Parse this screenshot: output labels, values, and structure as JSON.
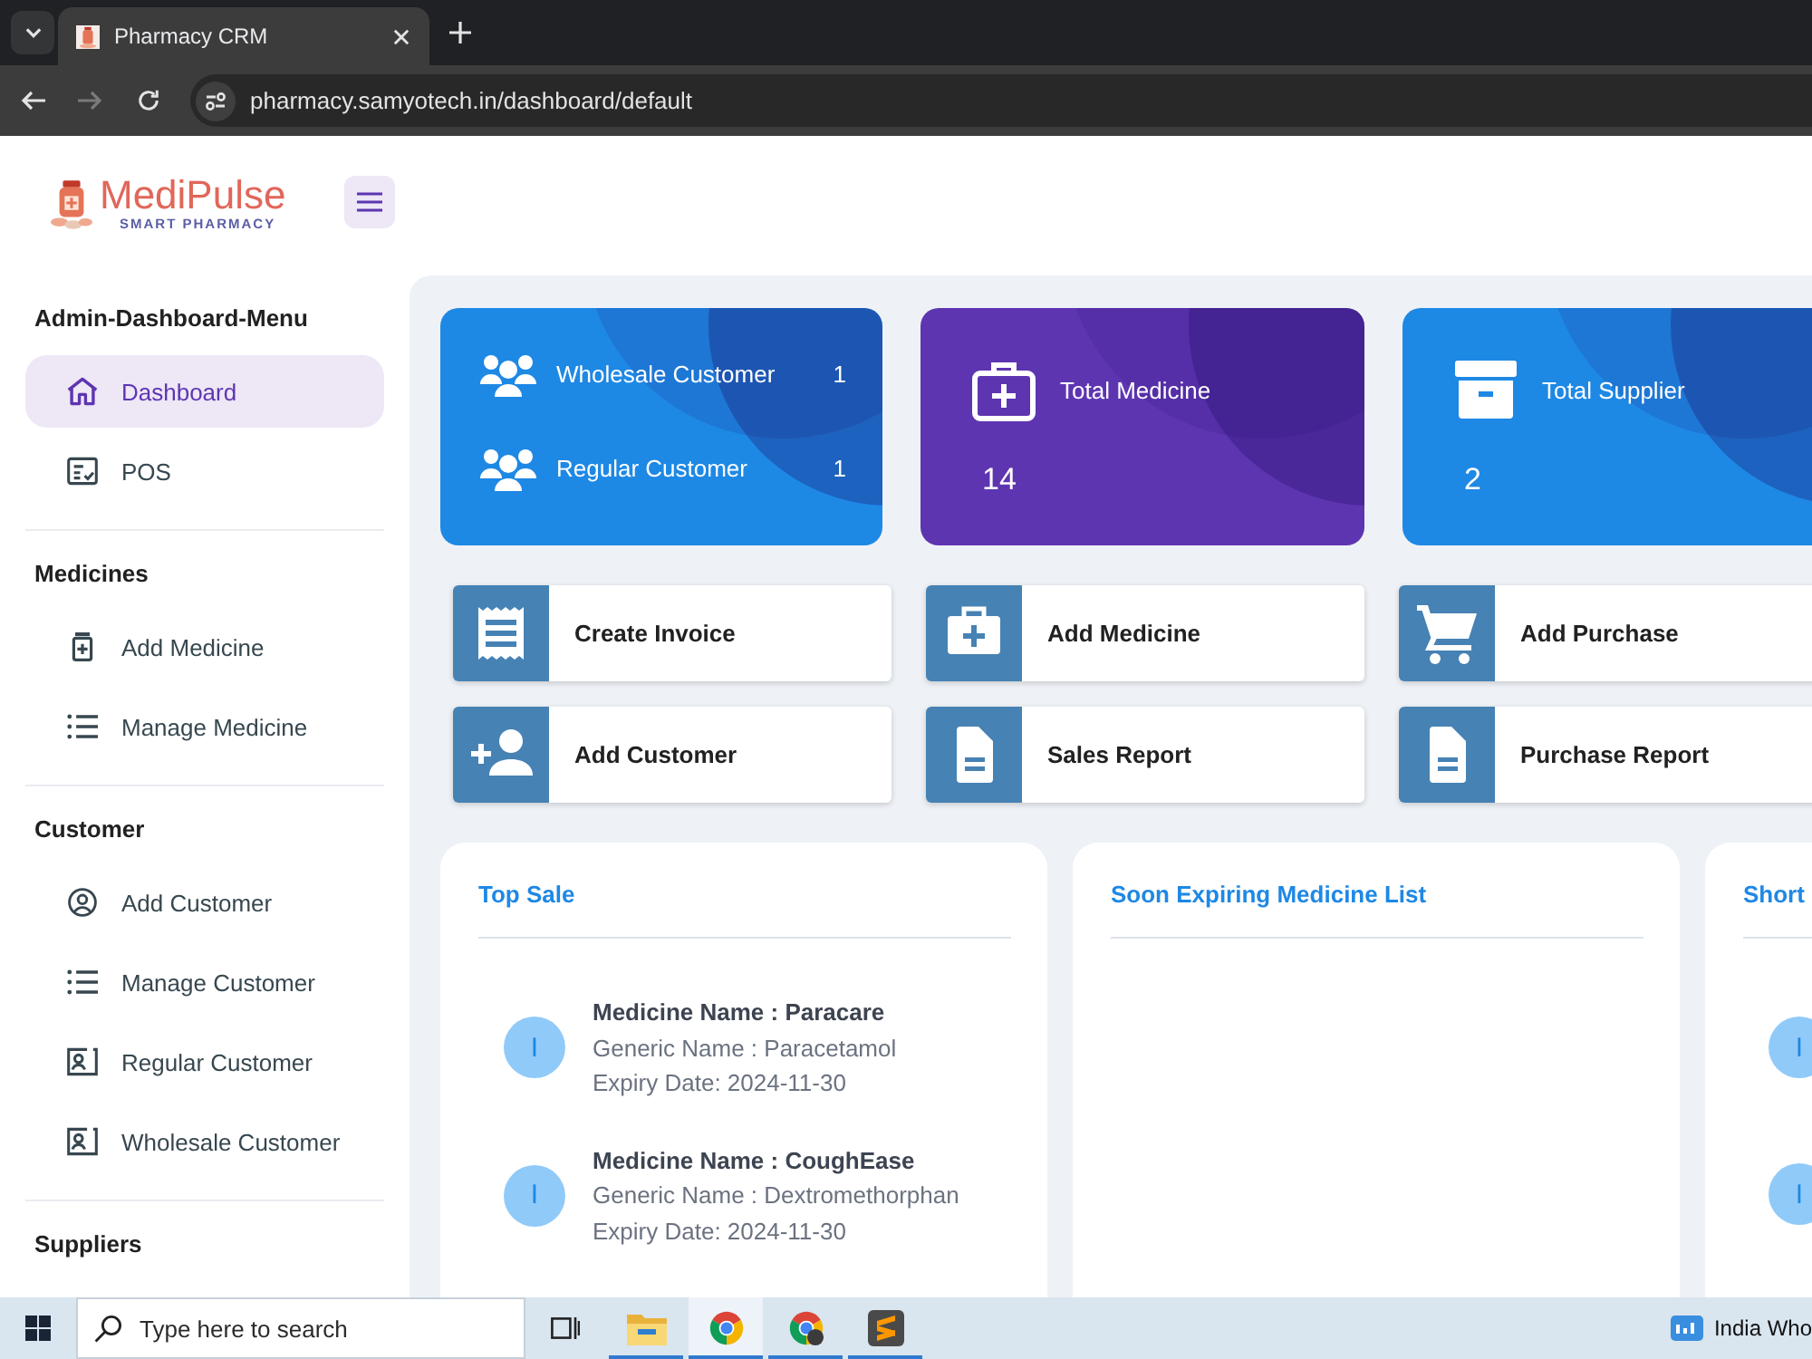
{
  "browser": {
    "tab": {
      "title": "Pharmacy CRM"
    },
    "nav": [
      {
        "kind": "back",
        "disabled": false
      },
      {
        "kind": "forward",
        "disabled": true
      },
      {
        "kind": "reload",
        "disabled": false
      }
    ],
    "url": "pharmacy.samyotech.in/dashboard/default"
  },
  "header": {
    "brand": "MediPulse",
    "tagline": "SMART PHARMACY"
  },
  "sidebar": {
    "sections": [
      {
        "title": "Admin-Dashboard-Menu",
        "items": [
          {
            "label": "Dashboard",
            "kind": "home",
            "selected": true
          },
          {
            "label": "POS",
            "kind": "checklist",
            "selected": false
          }
        ]
      },
      {
        "title": "Medicines",
        "items": [
          {
            "label": "Add Medicine",
            "kind": "medicine-box",
            "selected": false
          },
          {
            "label": "Manage Medicine",
            "kind": "list",
            "selected": false
          }
        ]
      },
      {
        "title": "Customer",
        "items": [
          {
            "label": "Add Customer",
            "kind": "user",
            "selected": false
          },
          {
            "label": "Manage Customer",
            "kind": "list",
            "selected": false
          },
          {
            "label": "Regular Customer",
            "kind": "contact",
            "selected": false
          },
          {
            "label": "Wholesale Customer",
            "kind": "contact",
            "selected": false
          }
        ]
      },
      {
        "title": "Suppliers"
      }
    ]
  },
  "stat_cards": [
    {
      "kind": "customers",
      "color": "#1e88e5",
      "rows": [
        {
          "label": "Wholesale Customer",
          "value": "1"
        },
        {
          "label": "Regular Customer",
          "value": "1"
        }
      ]
    },
    {
      "kind": "medicine",
      "color": "#5e35b1",
      "label": "Total Medicine",
      "value": "14"
    },
    {
      "kind": "supplier",
      "color": "#1e88e5",
      "label": "Total Supplier",
      "value": "2"
    }
  ],
  "quick_actions": [
    {
      "kind": "invoice",
      "label": "Create Invoice"
    },
    {
      "kind": "medicine",
      "label": "Add Medicine"
    },
    {
      "kind": "cart",
      "label": "Add Purchase"
    },
    {
      "kind": "add-user",
      "label": "Add Customer"
    },
    {
      "kind": "report",
      "label": "Sales Report"
    },
    {
      "kind": "report",
      "label": "Purchase Report"
    }
  ],
  "panels": [
    {
      "title": "Top Sale",
      "items": [
        {
          "avatar": "I",
          "name": "Medicine Name : Paracare",
          "generic": "Generic Name : Paracetamol",
          "expiry": "Expiry Date: 2024-11-30"
        },
        {
          "avatar": "I",
          "name": "Medicine Name : CoughEase",
          "generic": "Generic Name : Dextromethorphan",
          "expiry": "Expiry Date: 2024-11-30"
        }
      ]
    },
    {
      "title": "Soon Expiring Medicine List"
    },
    {
      "title": "Short",
      "items": [
        {
          "avatar": "I"
        },
        {
          "avatar": "I"
        }
      ]
    }
  ],
  "taskbar": {
    "search": {
      "placeholder": "Type here to search"
    },
    "apps": [
      {
        "kind": "explorer",
        "open": true,
        "selected": false
      },
      {
        "kind": "browser",
        "open": true,
        "selected": true
      },
      {
        "kind": "browser-profile",
        "open": true,
        "selected": false
      },
      {
        "kind": "editor",
        "open": true,
        "selected": false
      }
    ],
    "widget": "India Who"
  }
}
